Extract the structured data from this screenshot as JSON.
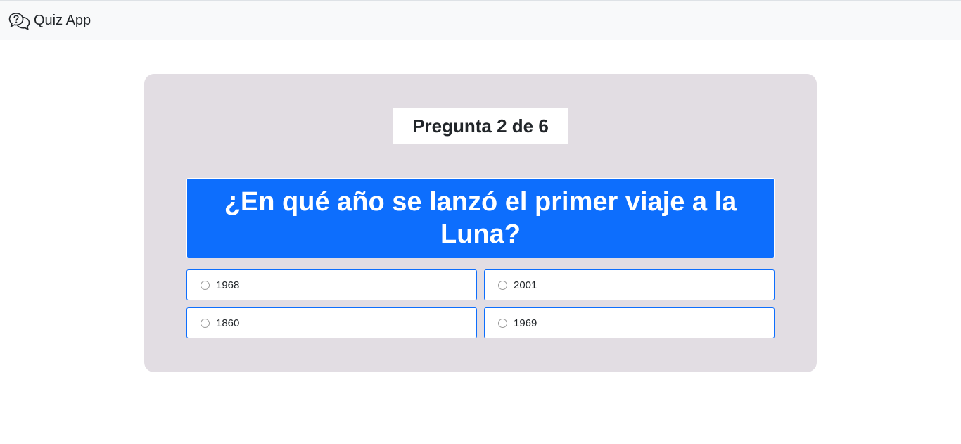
{
  "navbar": {
    "brand_label": "Quiz App",
    "brand_icon": "question-chat-icon"
  },
  "quiz": {
    "counter": "Pregunta 2 de 6",
    "question": "¿En qué año se lanzó el primer viaje a la Luna?",
    "options": [
      {
        "label": "1968",
        "selected": false
      },
      {
        "label": "2001",
        "selected": false
      },
      {
        "label": "1860",
        "selected": false
      },
      {
        "label": "1969",
        "selected": false
      }
    ]
  },
  "colors": {
    "primary": "#0d6efd",
    "card_background": "#e2dde3",
    "navbar_background": "#f8f9fa"
  }
}
